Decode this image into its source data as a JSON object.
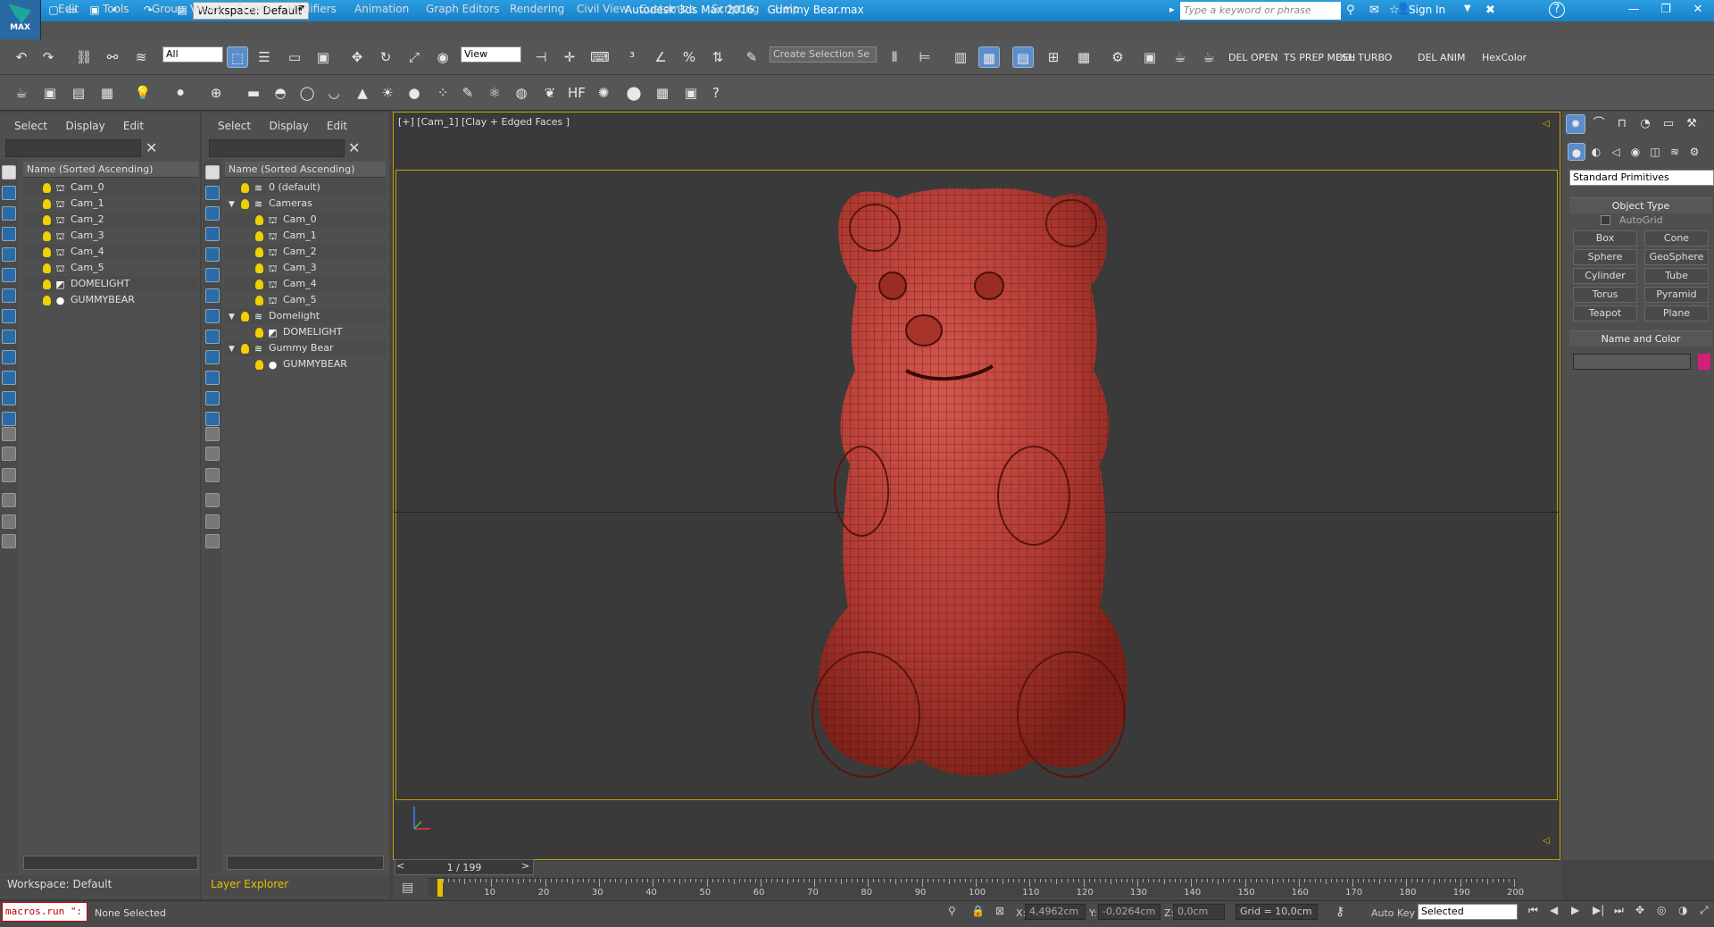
{
  "title": {
    "app": "Autodesk 3ds Max 2016",
    "file": "Gummy Bear.max",
    "workspace": "Workspace: Default",
    "search_placeholder": "Type a keyword or phrase",
    "sign_in": "Sign In",
    "logo": "MAX"
  },
  "menu": [
    "Edit",
    "Tools",
    "Group",
    "Views",
    "Create",
    "Modifiers",
    "Animation",
    "Graph Editors",
    "Rendering",
    "Civil View",
    "Customize",
    "Scripting",
    "Help"
  ],
  "toolbar": {
    "filter": "All",
    "refcoord": "View",
    "named_sel": "Create Selection Se",
    "custom": [
      "DEL OPEN",
      "TS PREP MESH",
      "DEL TURBO",
      "DEL ANIM",
      "HexColor"
    ]
  },
  "explorer1": {
    "tabs": [
      "Select",
      "Display",
      "Edit"
    ],
    "column": "Name (Sorted Ascending)",
    "items": [
      "Cam_0",
      "Cam_1",
      "Cam_2",
      "Cam_3",
      "Cam_4",
      "Cam_5",
      "DOMELIGHT",
      "GUMMYBEAR"
    ],
    "footer": "Workspace: Default"
  },
  "explorer2": {
    "tabs": [
      "Select",
      "Display",
      "Edit"
    ],
    "column": "Name (Sorted Ascending)",
    "items": [
      {
        "label": "0 (default)",
        "indent": 0,
        "type": "layer"
      },
      {
        "label": "Cameras",
        "indent": 0,
        "type": "layer",
        "open": true
      },
      {
        "label": "Cam_0",
        "indent": 1,
        "type": "cam"
      },
      {
        "label": "Cam_1",
        "indent": 1,
        "type": "cam"
      },
      {
        "label": "Cam_2",
        "indent": 1,
        "type": "cam"
      },
      {
        "label": "Cam_3",
        "indent": 1,
        "type": "cam"
      },
      {
        "label": "Cam_4",
        "indent": 1,
        "type": "cam"
      },
      {
        "label": "Cam_5",
        "indent": 1,
        "type": "cam"
      },
      {
        "label": "Domelight",
        "indent": 0,
        "type": "layer",
        "open": true
      },
      {
        "label": "DOMELIGHT",
        "indent": 1,
        "type": "light"
      },
      {
        "label": "Gummy Bear",
        "indent": 0,
        "type": "layer",
        "open": true
      },
      {
        "label": "GUMMYBEAR",
        "indent": 1,
        "type": "geo"
      }
    ],
    "footer": "Layer Explorer"
  },
  "viewport": {
    "label": "[+] [Cam_1] [Clay + Edged Faces ]"
  },
  "command_panel": {
    "category": "Standard Primitives",
    "object_type": "Object Type",
    "autogrid": "AutoGrid",
    "buttons": [
      "Box",
      "Cone",
      "Sphere",
      "GeoSphere",
      "Cylinder",
      "Tube",
      "Torus",
      "Pyramid",
      "Teapot",
      "Plane"
    ],
    "name_color": "Name and Color",
    "color": "#d0207a"
  },
  "timeline": {
    "frame": "1 / 199",
    "ticks": [
      "10",
      "20",
      "30",
      "40",
      "50",
      "60",
      "70",
      "80",
      "90",
      "100",
      "110",
      "120",
      "130",
      "140",
      "150",
      "160",
      "170",
      "180",
      "190",
      "200"
    ]
  },
  "status": {
    "macro": "macros.run \":",
    "selection": "None Selected",
    "x": "4,4962cm",
    "y": "-0,0264cm",
    "z": "0,0cm",
    "grid": "Grid = 10,0cm",
    "autokey": "Auto Key",
    "keymode": "Selected",
    "xl": "X:",
    "yl": "Y:",
    "zl": "Z:"
  }
}
